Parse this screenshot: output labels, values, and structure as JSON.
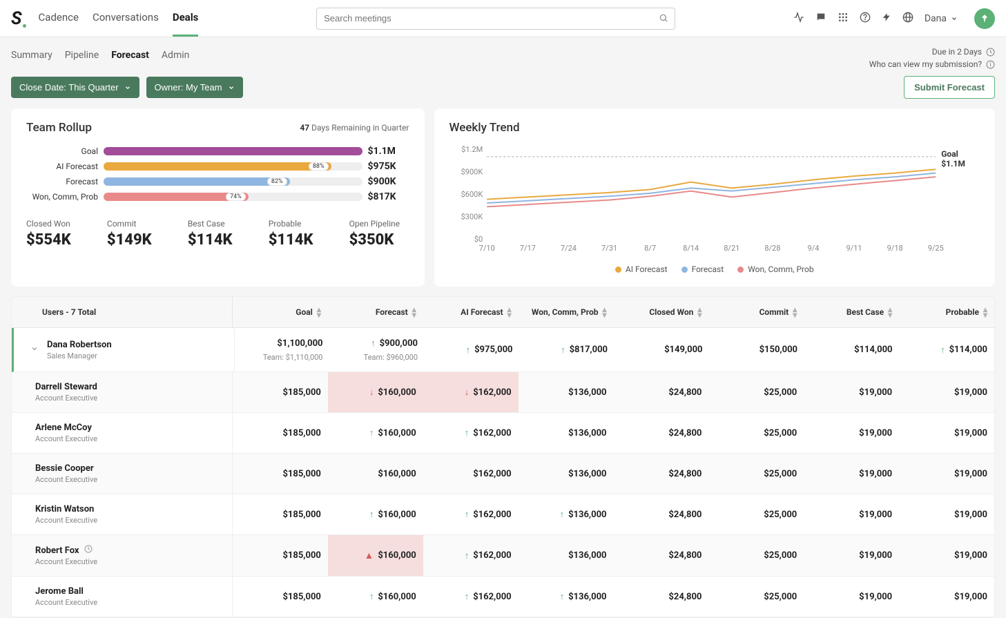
{
  "header": {
    "nav": [
      "Cadence",
      "Conversations",
      "Deals"
    ],
    "active_nav": "Deals",
    "search_placeholder": "Search meetings",
    "user_name": "Dana"
  },
  "subnav": {
    "items": [
      "Summary",
      "Pipeline",
      "Forecast",
      "Admin"
    ],
    "active": "Forecast",
    "due_text": "Due in 2 Days",
    "who_text": "Who can view my submission?"
  },
  "filters": {
    "close_date": "Close Date: This Quarter",
    "owner": "Owner: My Team",
    "submit_label": "Submit Forecast"
  },
  "rollup": {
    "title": "Team Rollup",
    "days_remaining_num": "47",
    "days_remaining_text": " Days Remaining in Quarter",
    "rows": [
      {
        "label": "Goal",
        "value": "$1.1M",
        "pct": null,
        "fill_pct": 100,
        "class": "goal"
      },
      {
        "label": "AI Forecast",
        "value": "$975K",
        "pct": "88%",
        "fill_pct": 88,
        "class": "ai"
      },
      {
        "label": "Forecast",
        "value": "$900K",
        "pct": "82%",
        "fill_pct": 72,
        "class": "fc"
      },
      {
        "label": "Won, Comm, Prob",
        "value": "$817K",
        "pct": "74%",
        "fill_pct": 56,
        "class": "won"
      }
    ],
    "stats": [
      {
        "label": "Closed Won",
        "value": "$554K"
      },
      {
        "label": "Commit",
        "value": "$149K"
      },
      {
        "label": "Best Case",
        "value": "$114K"
      },
      {
        "label": "Probable",
        "value": "$114K"
      },
      {
        "label": "Open Pipeline",
        "value": "$350K"
      }
    ]
  },
  "trend": {
    "title": "Weekly Trend",
    "goal_label": "Goal",
    "goal_value": "$1.1M",
    "legend": [
      "AI Forecast",
      "Forecast",
      "Won, Comm, Prob"
    ]
  },
  "chart_data": {
    "type": "line",
    "x": [
      "7/10",
      "7/17",
      "7/24",
      "7/31",
      "8/7",
      "8/14",
      "8/21",
      "8/28",
      "9/4",
      "9/11",
      "9/18",
      "9/25"
    ],
    "y_ticks": [
      "$0",
      "$300K",
      "$600K",
      "$900K",
      "$1.2M"
    ],
    "goal_line": 1100,
    "ylim": [
      0,
      1200
    ],
    "series": [
      {
        "name": "AI Forecast",
        "color": "#e9a93f",
        "values": [
          530,
          560,
          590,
          620,
          660,
          760,
          680,
          730,
          790,
          840,
          880,
          930
        ]
      },
      {
        "name": "Forecast",
        "color": "#8fb5e1",
        "values": [
          480,
          510,
          540,
          570,
          610,
          680,
          640,
          690,
          740,
          790,
          830,
          880
        ]
      },
      {
        "name": "Won, Comm, Prob",
        "color": "#e98a8a",
        "values": [
          430,
          460,
          490,
          520,
          570,
          640,
          560,
          620,
          680,
          730,
          780,
          830
        ]
      }
    ]
  },
  "table": {
    "headers": [
      "Users - 7 Total",
      "Goal",
      "Forecast",
      "AI Forecast",
      "Won, Comm, Prob",
      "Closed Won",
      "Commit",
      "Best Case",
      "Probable"
    ],
    "rows": [
      {
        "name": "Dana Robertson",
        "role": "Sales Manager",
        "expanded": true,
        "cells": [
          {
            "val": "$1,100,000",
            "sub": "Team: $1,110,000"
          },
          {
            "val": "$900,000",
            "sub": "Team: $960,000",
            "arrow": "up"
          },
          {
            "val": "$975,000",
            "arrow": "up"
          },
          {
            "val": "$817,000",
            "arrow": "up"
          },
          {
            "val": "$149,000"
          },
          {
            "val": "$150,000"
          },
          {
            "val": "$114,000"
          },
          {
            "val": "$114,000",
            "arrow": "up"
          }
        ]
      },
      {
        "name": "Darrell Steward",
        "role": "Account Executive",
        "cells": [
          {
            "val": "$185,000"
          },
          {
            "val": "$160,000",
            "arrow": "down",
            "neg": true
          },
          {
            "val": "$162,000",
            "arrow": "down",
            "neg": true
          },
          {
            "val": "$136,000"
          },
          {
            "val": "$24,800"
          },
          {
            "val": "$25,000"
          },
          {
            "val": "$19,000"
          },
          {
            "val": "$19,000"
          }
        ]
      },
      {
        "name": "Arlene McCoy",
        "role": "Account Executive",
        "cells": [
          {
            "val": "$185,000"
          },
          {
            "val": "$160,000",
            "arrow": "up"
          },
          {
            "val": "$162,000",
            "arrow": "up"
          },
          {
            "val": "$136,000"
          },
          {
            "val": "$24,800"
          },
          {
            "val": "$25,000"
          },
          {
            "val": "$19,000"
          },
          {
            "val": "$19,000"
          }
        ]
      },
      {
        "name": "Bessie Cooper",
        "role": "Account Executive",
        "cells": [
          {
            "val": "$185,000"
          },
          {
            "val": "$160,000"
          },
          {
            "val": "$162,000"
          },
          {
            "val": "$136,000"
          },
          {
            "val": "$24,800"
          },
          {
            "val": "$25,000"
          },
          {
            "val": "$19,000"
          },
          {
            "val": "$19,000"
          }
        ]
      },
      {
        "name": "Kristin Watson",
        "role": "Account Executive",
        "cells": [
          {
            "val": "$185,000"
          },
          {
            "val": "$160,000",
            "arrow": "up"
          },
          {
            "val": "$162,000",
            "arrow": "up"
          },
          {
            "val": "$136,000",
            "arrow": "up"
          },
          {
            "val": "$24,800"
          },
          {
            "val": "$25,000"
          },
          {
            "val": "$19,000"
          },
          {
            "val": "$19,000"
          }
        ]
      },
      {
        "name": "Robert Fox",
        "role": "Account Executive",
        "clock": true,
        "cells": [
          {
            "val": "$185,000"
          },
          {
            "val": "$160,000",
            "warn": true,
            "neg": true
          },
          {
            "val": "$162,000",
            "arrow": "up"
          },
          {
            "val": "$136,000"
          },
          {
            "val": "$24,800"
          },
          {
            "val": "$25,000"
          },
          {
            "val": "$19,000"
          },
          {
            "val": "$19,000"
          }
        ]
      },
      {
        "name": "Jerome Ball",
        "role": "Account Executive",
        "cells": [
          {
            "val": "$185,000"
          },
          {
            "val": "$160,000",
            "arrow": "up"
          },
          {
            "val": "$162,000",
            "arrow": "up"
          },
          {
            "val": "$136,000",
            "arrow": "up"
          },
          {
            "val": "$24,800"
          },
          {
            "val": "$25,000"
          },
          {
            "val": "$19,000"
          },
          {
            "val": "$19,000"
          }
        ]
      }
    ]
  }
}
